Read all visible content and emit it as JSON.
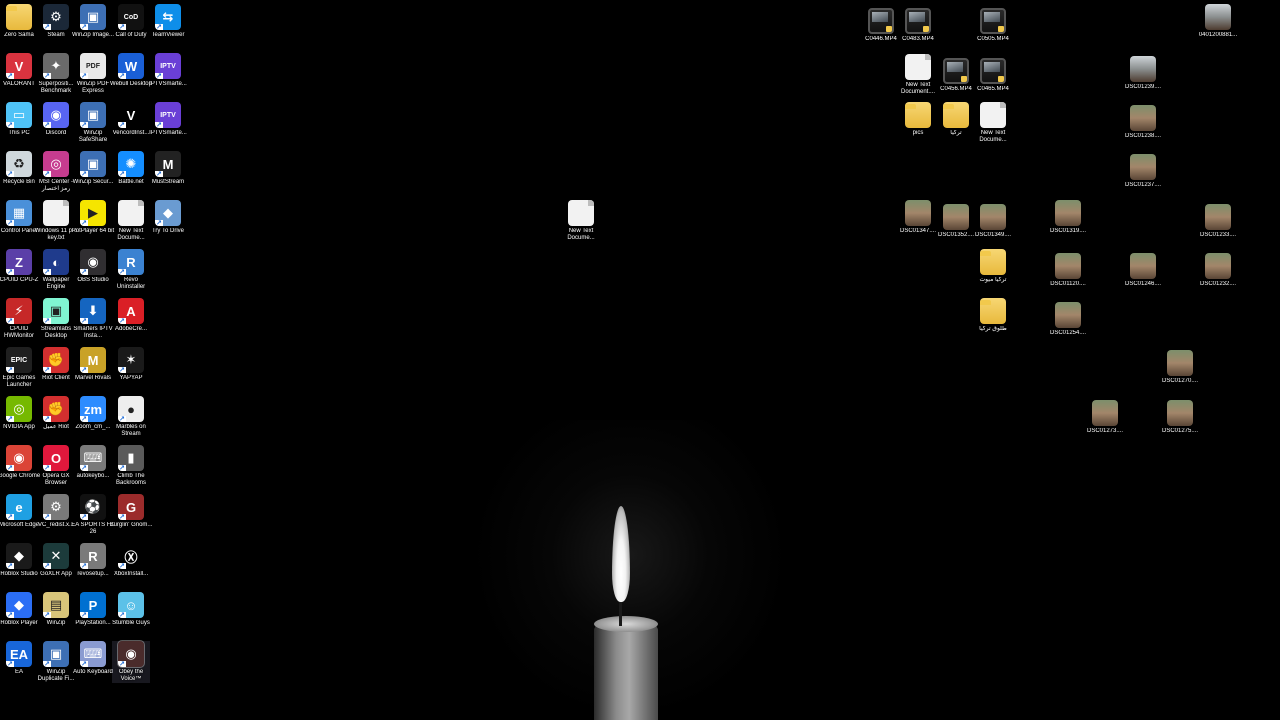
{
  "left_icons": [
    {
      "name": "zero-sama-folder",
      "label": "Zero Sama",
      "icon": "folder-icon",
      "color": "#f2c94c",
      "glyph": ""
    },
    {
      "name": "steam-shortcut",
      "label": "Steam",
      "icon": "steam-icon",
      "color": "#1b2838",
      "glyph": "⚙"
    },
    {
      "name": "winzip-image-shortcut",
      "label": "WinZip Image...",
      "icon": "winzip-image-icon",
      "color": "#3d6fb4",
      "glyph": "▣"
    },
    {
      "name": "call-of-duty-shortcut",
      "label": "Call of Duty",
      "icon": "call-of-duty-icon",
      "color": "#111111",
      "glyph": "CoD"
    },
    {
      "name": "teamviewer-shortcut",
      "label": "TeamViewer",
      "icon": "teamviewer-icon",
      "color": "#0e8ee9",
      "glyph": "⇆"
    },
    {
      "name": "valorant-shortcut",
      "label": "VALORANT",
      "icon": "valorant-icon",
      "color": "#d9333f",
      "glyph": "V"
    },
    {
      "name": "superposition-shortcut",
      "label": "Superpositi... Benchmark",
      "icon": "superposition-icon",
      "color": "#6a6a6a",
      "glyph": "✦"
    },
    {
      "name": "winzip-pdf-shortcut",
      "label": "WinZip PDF Express",
      "icon": "winzip-pdf-icon",
      "color": "#e9e9e9",
      "glyph": "PDF"
    },
    {
      "name": "webull-shortcut",
      "label": "Webull Desktop",
      "icon": "webull-icon",
      "color": "#1a5fd6",
      "glyph": "W"
    },
    {
      "name": "iptv-smarters-1-shortcut",
      "label": "IPTVSmarte...",
      "icon": "iptv-icon",
      "color": "#6a3fd6",
      "glyph": "IPTV"
    },
    {
      "name": "this-pc-shortcut",
      "label": "This PC",
      "icon": "monitor-icon",
      "color": "#4fc3f7",
      "glyph": "▭"
    },
    {
      "name": "discord-shortcut",
      "label": "Discord",
      "icon": "discord-icon",
      "color": "#5865f2",
      "glyph": "◉"
    },
    {
      "name": "winzip-safeshare-shortcut",
      "label": "WinZip SafeShare",
      "icon": "winzip-safeshare-icon",
      "color": "#3d6fb4",
      "glyph": "▣"
    },
    {
      "name": "vencord-shortcut",
      "label": "VencordInst...",
      "icon": "vencord-icon",
      "color": "#000000",
      "glyph": "V"
    },
    {
      "name": "iptv-smarters-2-shortcut",
      "label": "IPTVSmarte...",
      "icon": "iptv-icon",
      "color": "#6a3fd6",
      "glyph": "IPTV"
    },
    {
      "name": "recycle-bin",
      "label": "Recycle Bin",
      "icon": "recycle-bin-icon",
      "color": "#cfd8dc",
      "glyph": "♻"
    },
    {
      "name": "msi-center-shortcut",
      "label": "MSI Center - رمز اختصار",
      "icon": "msi-center-icon",
      "color": "#c63c8f",
      "glyph": "◎"
    },
    {
      "name": "winzip-secure-shortcut",
      "label": "WinZip Secur...",
      "icon": "winzip-secure-icon",
      "color": "#3d6fb4",
      "glyph": "▣"
    },
    {
      "name": "battlenet-shortcut",
      "label": "Battle.net",
      "icon": "battlenet-icon",
      "color": "#148eff",
      "glyph": "✺"
    },
    {
      "name": "mustream-shortcut",
      "label": "MustStream",
      "icon": "muststream-icon",
      "color": "#222222",
      "glyph": "M"
    },
    {
      "name": "control-panel-shortcut",
      "label": "Control Panel",
      "icon": "control-panel-icon",
      "color": "#4a90d9",
      "glyph": "▦"
    },
    {
      "name": "windows-key-file",
      "label": "Windows 11 pro key.txt",
      "icon": "text-file-icon",
      "color": "#f2f2f2",
      "glyph": ""
    },
    {
      "name": "potplayer-shortcut",
      "label": "PotPlayer 64 bit",
      "icon": "potplayer-icon",
      "color": "#f5e500",
      "glyph": "▶"
    },
    {
      "name": "new-text-document-left",
      "label": "New Text Docume...",
      "icon": "text-file-icon",
      "color": "#f2f2f2",
      "glyph": ""
    },
    {
      "name": "try-to-drive-shortcut",
      "label": "Try To Drive",
      "icon": "try-to-drive-icon",
      "color": "#6a9bd1",
      "glyph": "◆"
    },
    {
      "name": "cpuz-shortcut",
      "label": "CPUID CPU-Z",
      "icon": "cpuz-icon",
      "color": "#5b3fa8",
      "glyph": "Z"
    },
    {
      "name": "wallpaper-engine-shortcut",
      "label": "Wallpaper Engine",
      "icon": "wallpaper-engine-icon",
      "color": "#1f3b8c",
      "glyph": "◐"
    },
    {
      "name": "obs-studio-shortcut",
      "label": "OBS Studio",
      "icon": "obs-icon",
      "color": "#302e31",
      "glyph": "◉"
    },
    {
      "name": "revo-uninstaller-shortcut",
      "label": "Revo Uninstaller",
      "icon": "revo-icon",
      "color": "#3b82d1",
      "glyph": "R"
    },
    {
      "name": "hwmonitor-shortcut",
      "label": "CPUID HWMonitor",
      "icon": "hwmonitor-icon",
      "color": "#c62828",
      "glyph": "⚡"
    },
    {
      "name": "streamlabs-shortcut",
      "label": "Streamlabs Desktop",
      "icon": "streamlabs-icon",
      "color": "#80f5d2",
      "glyph": "▣"
    },
    {
      "name": "smarters-iptv-shortcut",
      "label": "Smarters IPTV Insta...",
      "icon": "download-icon",
      "color": "#1565c0",
      "glyph": "⬇"
    },
    {
      "name": "adobe-shortcut",
      "label": "AdobeCre...",
      "icon": "adobe-icon",
      "color": "#da1f26",
      "glyph": "A"
    },
    {
      "name": "epic-games-shortcut",
      "label": "Epic Games Launcher",
      "icon": "epic-games-icon",
      "color": "#1f1f1f",
      "glyph": "EPIC"
    },
    {
      "name": "riot-client-shortcut",
      "label": "Riot Client",
      "icon": "riot-icon",
      "color": "#d32f2f",
      "glyph": "✊"
    },
    {
      "name": "marvel-rivals-shortcut",
      "label": "Marvel Rivals",
      "icon": "marvel-rivals-icon",
      "color": "#c9a227",
      "glyph": "M"
    },
    {
      "name": "yapyap-shortcut",
      "label": "YAPYAP",
      "icon": "yapyap-icon",
      "color": "#1a1a1a",
      "glyph": "✶"
    },
    {
      "name": "nvidia-app-shortcut",
      "label": "NVIDIA App",
      "icon": "nvidia-icon",
      "color": "#76b900",
      "glyph": "◎"
    },
    {
      "name": "riot-arabic-shortcut",
      "label": "عميل Riot",
      "icon": "riot-icon",
      "color": "#d32f2f",
      "glyph": "✊"
    },
    {
      "name": "zoom-shortcut",
      "label": "Zoom_cm_...",
      "icon": "zoom-icon",
      "color": "#2d8cff",
      "glyph": "zm"
    },
    {
      "name": "marbles-on-stream-shortcut",
      "label": "Marbles on Stream",
      "icon": "marbles-icon",
      "color": "#eeeeee",
      "glyph": "●"
    },
    {
      "name": "google-chrome-shortcut",
      "label": "Google Chrome",
      "icon": "chrome-icon",
      "color": "#db4437",
      "glyph": "◉"
    },
    {
      "name": "opera-gx-shortcut",
      "label": "Opera GX Browser",
      "icon": "opera-gx-icon",
      "color": "#e0183c",
      "glyph": "O"
    },
    {
      "name": "autokeyboard-shortcut",
      "label": "autokeybo...",
      "icon": "installer-icon",
      "color": "#7a7a7a",
      "glyph": "⌨"
    },
    {
      "name": "climb-the-backrooms-shortcut",
      "label": "Climb The Backrooms",
      "icon": "climb-icon",
      "color": "#5a5a5a",
      "glyph": "▮"
    },
    {
      "name": "microsoft-edge-shortcut",
      "label": "Microsoft Edge",
      "icon": "edge-icon",
      "color": "#1fa0e3",
      "glyph": "e"
    },
    {
      "name": "vc-redist-shortcut",
      "label": "VC_redist.x...",
      "icon": "installer-icon",
      "color": "#7a7a7a",
      "glyph": "⚙"
    },
    {
      "name": "ea-sports-fc-shortcut",
      "label": "EA SPORTS FC 26",
      "icon": "ea-fc-icon",
      "color": "#111111",
      "glyph": "⚽"
    },
    {
      "name": "burglin-gnomes-shortcut",
      "label": "Burglin' Gnom...",
      "icon": "gnomes-icon",
      "color": "#9b2b2b",
      "glyph": "G"
    },
    {
      "name": "roblox-studio-shortcut",
      "label": "Roblox Studio",
      "icon": "roblox-studio-icon",
      "color": "#1a1a1a",
      "glyph": "◆"
    },
    {
      "name": "goxlr-shortcut",
      "label": "GoXLR App",
      "icon": "goxlr-icon",
      "color": "#1c3b3b",
      "glyph": "✕"
    },
    {
      "name": "revosetup-shortcut",
      "label": "revosetup...",
      "icon": "installer-icon",
      "color": "#7a7a7a",
      "glyph": "R"
    },
    {
      "name": "xbox-installer-shortcut",
      "label": "XboxInstall...",
      "icon": "xbox-icon",
      "color": "#000000",
      "glyph": "Ⓧ"
    },
    {
      "name": "roblox-player-shortcut",
      "label": "Roblox Player",
      "icon": "roblox-icon",
      "color": "#2b6ef5",
      "glyph": "◆"
    },
    {
      "name": "winzip-shortcut",
      "label": "WinZip",
      "icon": "winzip-icon",
      "color": "#d8c57a",
      "glyph": "▤"
    },
    {
      "name": "playstation-shortcut",
      "label": "PlayStation...",
      "icon": "playstation-icon",
      "color": "#0070d1",
      "glyph": "P"
    },
    {
      "name": "stumble-guys-shortcut",
      "label": "Stumble Guys",
      "icon": "stumble-guys-icon",
      "color": "#5cc1e8",
      "glyph": "☺"
    },
    {
      "name": "ea-shortcut",
      "label": "EA",
      "icon": "ea-icon",
      "color": "#1866d9",
      "glyph": "EA"
    },
    {
      "name": "winzip-duplicate-shortcut",
      "label": "WinZip Duplicate Fi...",
      "icon": "winzip-duplicate-icon",
      "color": "#3d6fb4",
      "glyph": "▣"
    },
    {
      "name": "auto-keyboard-shortcut",
      "label": "Auto Keyboard",
      "icon": "keyboard-icon",
      "color": "#8a9bd1",
      "glyph": "⌨"
    },
    {
      "name": "obey-the-voice-shortcut",
      "label": "Obey the Voice™",
      "icon": "obey-voice-icon",
      "color": "#4a2b2b",
      "glyph": "◉"
    }
  ],
  "right_icons": [
    {
      "name": "video-c0446",
      "label": "C0446.MP4",
      "icon": "video-file-icon"
    },
    {
      "name": "video-c0483",
      "label": "C0483.MP4",
      "icon": "video-file-icon"
    },
    {
      "name": "video-c0505",
      "label": "C0505.MP4",
      "icon": "video-file-icon"
    },
    {
      "name": "photo-0401200881",
      "label": "0401200881...",
      "icon": "photo-file-icon"
    },
    {
      "name": "new-text-document-right-1",
      "label": "New Text Document....",
      "icon": "text-file-icon"
    },
    {
      "name": "video-c0456",
      "label": "C0456.MP4",
      "icon": "video-file-icon"
    },
    {
      "name": "video-c0465",
      "label": "C0465.MP4",
      "icon": "video-file-icon"
    },
    {
      "name": "photo-dsc01239",
      "label": "DSC01239....",
      "icon": "photo-file-icon"
    },
    {
      "name": "folder-pics",
      "label": "pics",
      "icon": "folder-icon"
    },
    {
      "name": "folder-turkey",
      "label": "تركيا",
      "icon": "folder-icon"
    },
    {
      "name": "new-text-document-right-2",
      "label": "New Text Docume...",
      "icon": "text-file-icon"
    },
    {
      "name": "photo-dsc01238",
      "label": "DSC01238....",
      "icon": "photo-file-icon"
    },
    {
      "name": "photo-dsc01237",
      "label": "DSC01237....",
      "icon": "photo-file-icon"
    },
    {
      "name": "new-text-document-center",
      "label": "New Text Docume...",
      "icon": "text-file-icon"
    },
    {
      "name": "photo-dsc01347",
      "label": "DSC01347....",
      "icon": "photo-file-icon"
    },
    {
      "name": "photo-dsc01352",
      "label": "DSC01352....",
      "icon": "photo-file-icon"
    },
    {
      "name": "photo-dsc01349",
      "label": "DSC01349....",
      "icon": "photo-file-icon"
    },
    {
      "name": "photo-dsc01319",
      "label": "DSC01319....",
      "icon": "photo-file-icon"
    },
    {
      "name": "photo-dsc01233",
      "label": "DSC01233....",
      "icon": "photo-file-icon"
    },
    {
      "name": "folder-turkey-videos",
      "label": "تركيا ميوت",
      "icon": "folder-icon"
    },
    {
      "name": "photo-dsc01120",
      "label": "DSC01120....",
      "icon": "photo-file-icon"
    },
    {
      "name": "photo-dsc01246",
      "label": "DSC01246....",
      "icon": "photo-file-icon"
    },
    {
      "name": "photo-dsc01232",
      "label": "DSC01232....",
      "icon": "photo-file-icon"
    },
    {
      "name": "folder-trabzon-turkey",
      "label": "طلوق تركيا",
      "icon": "folder-icon"
    },
    {
      "name": "photo-dsc01254",
      "label": "DSC01254....",
      "icon": "photo-file-icon"
    },
    {
      "name": "photo-dsc01270",
      "label": "DSC01270....",
      "icon": "photo-file-icon"
    },
    {
      "name": "photo-dsc01273",
      "label": "DSC01273....",
      "icon": "photo-file-icon"
    },
    {
      "name": "photo-dsc01275",
      "label": "DSC01275....",
      "icon": "photo-file-icon"
    }
  ],
  "selected_icon": "Obey the Voice™",
  "wallpaper": "candle-on-black"
}
